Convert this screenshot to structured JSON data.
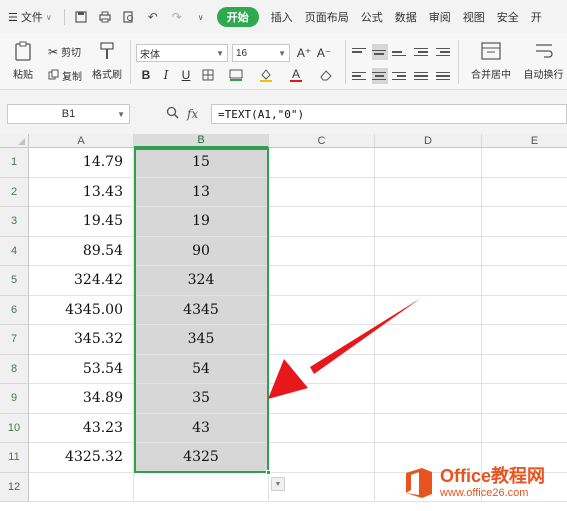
{
  "menubar": {
    "menu_label": "文件",
    "tabs": [
      "开始",
      "插入",
      "页面布局",
      "公式",
      "数据",
      "审阅",
      "视图",
      "安全",
      "开"
    ],
    "active_tab_index": 0
  },
  "ribbon": {
    "paste": "粘贴",
    "cut": "剪切",
    "copy": "复制",
    "format_painter": "格式刷",
    "font_name": "宋体",
    "font_size": "16",
    "grow_font": "A⁺",
    "shrink_font": "A⁻",
    "bold": "B",
    "italic": "I",
    "underline": "U",
    "font_color_glyph": "A",
    "merge_center": "合并居中",
    "wrap_text": "自动换行"
  },
  "formula_bar": {
    "name_box": "B1",
    "formula": "=TEXT(A1,\"0\")"
  },
  "grid": {
    "columns": [
      "A",
      "B",
      "C",
      "D",
      "E"
    ],
    "selected_column": "B",
    "rows": [
      {
        "n": "1",
        "a": "14.79",
        "b": "15"
      },
      {
        "n": "2",
        "a": "13.43",
        "b": "13"
      },
      {
        "n": "3",
        "a": "19.45",
        "b": "19"
      },
      {
        "n": "4",
        "a": "89.54",
        "b": "90"
      },
      {
        "n": "5",
        "a": "324.42",
        "b": "324"
      },
      {
        "n": "6",
        "a": "4345.00",
        "b": "4345"
      },
      {
        "n": "7",
        "a": "345.32",
        "b": "345"
      },
      {
        "n": "8",
        "a": "53.54",
        "b": "54"
      },
      {
        "n": "9",
        "a": "34.89",
        "b": "35"
      },
      {
        "n": "10",
        "a": "43.23",
        "b": "43"
      },
      {
        "n": "11",
        "a": "4325.32",
        "b": "4325"
      },
      {
        "n": "12",
        "a": "",
        "b": ""
      }
    ]
  },
  "colors": {
    "accent_green": "#2fa04e",
    "selection_fill": "#d7d7d7",
    "arrow_red": "#e8171b",
    "watermark_orange": "#e8541f"
  },
  "watermark": {
    "title": "Office教程网",
    "url": "www.office26.com"
  }
}
